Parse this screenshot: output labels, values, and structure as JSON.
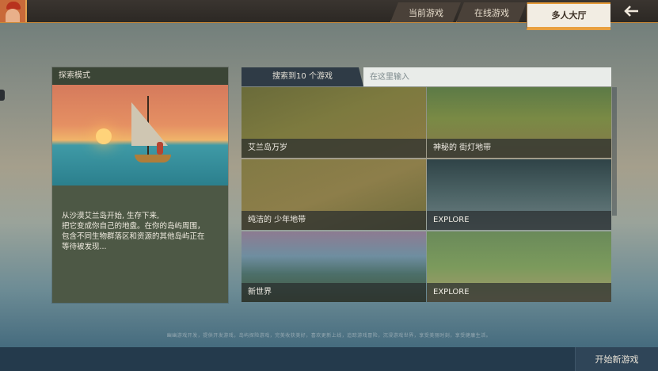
{
  "nav": {
    "tabs": [
      {
        "label": "当前游戏"
      },
      {
        "label": "在线游戏"
      },
      {
        "label": "多人大厅"
      }
    ],
    "active_tab": "多人大厅",
    "back_icon": "back-arrow-icon",
    "avatar_icon": "avatar-icon"
  },
  "mode_panel": {
    "header": "探索模式",
    "description": "从沙漠艾兰岛开始, 生存下来,\n把它变成你自己的地盘。在你的岛屿周围，\n包含不同生物群落区和资源的其他岛屿正在\n等待被发现..."
  },
  "search": {
    "result_label": "搜索到10 个游戏",
    "placeholder": "在这里输入"
  },
  "games": [
    {
      "name": "艾兰岛万岁"
    },
    {
      "name": "神秘的 街灯地带"
    },
    {
      "name": "纯洁的 少年地带"
    },
    {
      "name": "EXPLORE"
    },
    {
      "name": "新世界"
    },
    {
      "name": "EXPLORE"
    }
  ],
  "footer": {
    "hint": "幽幽游戏开发，提供开发游戏，岛屿探险游戏，完美收获美好，喜欢更新上线，追踪游戏冒险，沉浸游戏世界，享受美丽时刻，享受健康生活。",
    "new_game_label": "开始新游戏"
  },
  "colors": {
    "accent": "#e8a040",
    "topbar": "#2c2824",
    "panel": "#4d5845",
    "bottombar": "#243a4c"
  }
}
